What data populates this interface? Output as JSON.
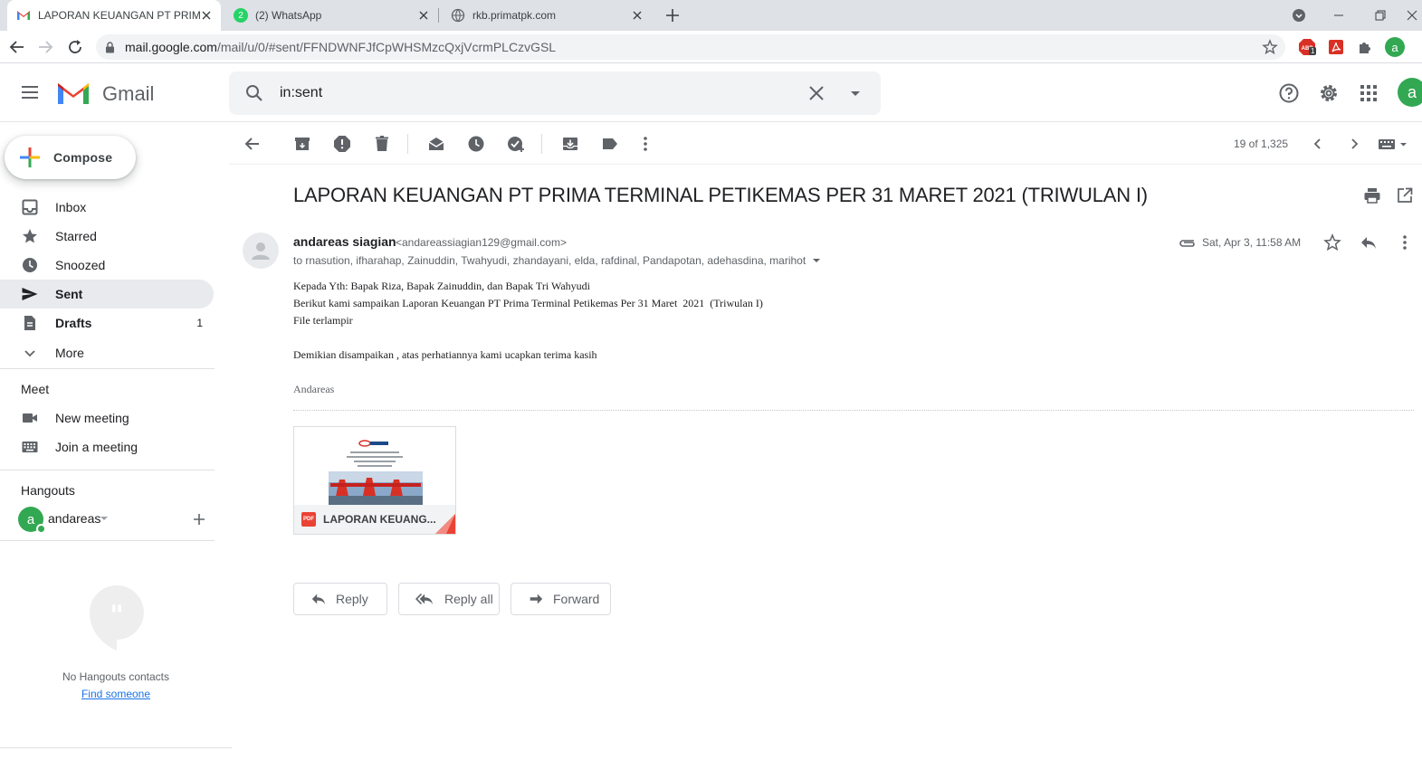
{
  "browser": {
    "tabs": [
      {
        "title": "LAPORAN KEUANGAN PT PRIMA",
        "active": true
      },
      {
        "title": "(2) WhatsApp",
        "active": false,
        "badge": "2"
      },
      {
        "title": "rkb.primatpk.com",
        "active": false
      }
    ],
    "url_host": "mail.google.com",
    "url_path": "/mail/u/0/#sent/FFNDWNFJfCpWHSMzcQxjVcrmPLCzvGSL",
    "profile_initial": "a",
    "ext_badge": "1"
  },
  "gmail": {
    "wordmark": "Gmail",
    "search_value": "in:sent",
    "account_initial": "a",
    "compose_label": "Compose",
    "nav": [
      {
        "label": "Inbox",
        "count": "",
        "icon": "inbox-icon"
      },
      {
        "label": "Starred",
        "count": "",
        "icon": "star-icon"
      },
      {
        "label": "Snoozed",
        "count": "",
        "icon": "clock-icon"
      },
      {
        "label": "Sent",
        "count": "",
        "icon": "send-icon",
        "active": true
      },
      {
        "label": "Drafts",
        "count": "1",
        "icon": "draft-icon"
      },
      {
        "label": "More",
        "count": "",
        "icon": "chevron-down-icon"
      }
    ],
    "meet": {
      "title": "Meet",
      "new_meeting": "New meeting",
      "join_meeting": "Join a meeting"
    },
    "hangouts": {
      "title": "Hangouts",
      "user_initial": "a",
      "user_name": "andareas",
      "empty_text": "No Hangouts contacts",
      "find_link": "Find someone"
    },
    "pager": "19 of 1,325"
  },
  "message": {
    "subject": "LAPORAN KEUANGAN PT PRIMA TERMINAL PETIKEMAS PER 31 MARET 2021 (TRIWULAN I)",
    "sender_name": "andareas siagian",
    "sender_email": "<andareassiagian129@gmail.com>",
    "recipients": "to rnasution, ifharahap, Zainuddin, Twahyudi, zhandayani, elda, rafdinal, Pandapotan, adehasdina, marihot",
    "date": "Sat, Apr 3, 11:58 AM",
    "body": [
      "Kepada Yth: Bapak Riza, Bapak Zainuddin, dan Bapak Tri Wahyudi",
      "Berikut kami sampaikan Laporan Keuangan PT Prima Terminal Petikemas Per 31 Maret  2021  (Triwulan I)",
      "File terlampir",
      "Demikian disampaikan , atas perhatiannya kami ucapkan terima kasih"
    ],
    "signature": "Andareas",
    "attachment": {
      "name": "LAPORAN KEUANG...",
      "type_label": "PDF"
    },
    "actions": {
      "reply": "Reply",
      "reply_all": "Reply all",
      "forward": "Forward"
    }
  }
}
